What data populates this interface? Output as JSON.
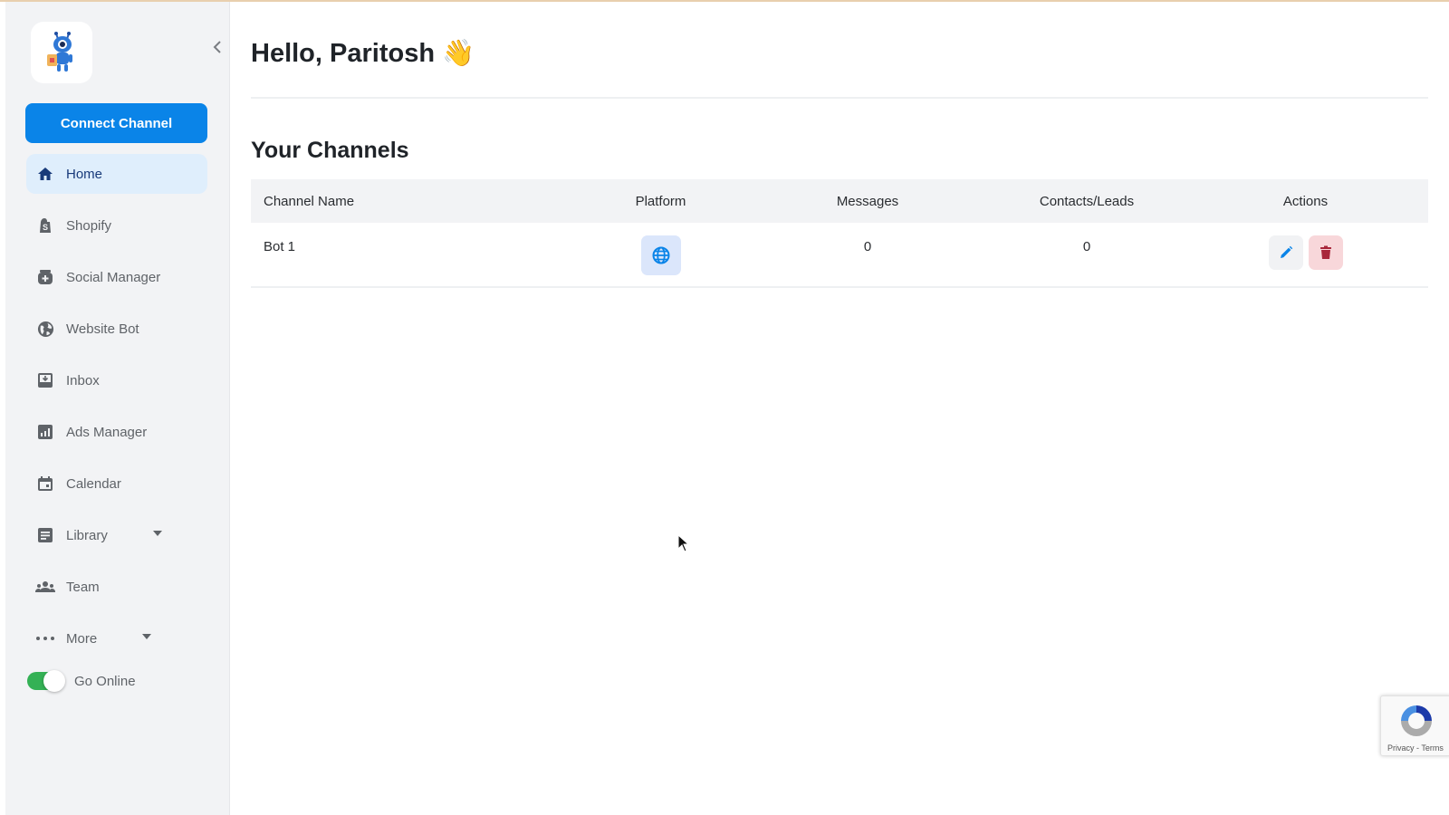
{
  "sidebar": {
    "logo_alt": "Robot mascot logo",
    "collapse_icon": "chevron-left-icon",
    "connect_button": "Connect Channel",
    "items": [
      {
        "label": "Home",
        "icon": "home-icon",
        "active": true
      },
      {
        "label": "Shopify",
        "icon": "shopify-bag-icon"
      },
      {
        "label": "Social Manager",
        "icon": "social-add-icon"
      },
      {
        "label": "Website Bot",
        "icon": "globe-icon"
      },
      {
        "label": "Inbox",
        "icon": "inbox-icon"
      },
      {
        "label": "Ads Manager",
        "icon": "bar-chart-icon"
      },
      {
        "label": "Calendar",
        "icon": "calendar-icon"
      },
      {
        "label": "Library",
        "icon": "library-icon",
        "has_dropdown": true
      },
      {
        "label": "Team",
        "icon": "team-icon"
      },
      {
        "label": "More",
        "icon": "more-dots-icon",
        "has_dropdown": true
      }
    ],
    "go_online": {
      "label": "Go Online",
      "enabled": true
    }
  },
  "main": {
    "greeting": "Hello, Paritosh 👋",
    "section_title": "Your Channels",
    "table": {
      "headers": [
        "Channel Name",
        "Platform",
        "Messages",
        "Contacts/Leads",
        "Actions"
      ],
      "rows": [
        {
          "channel_name": "Bot 1",
          "platform": "website",
          "platform_icon": "globe-icon",
          "messages": "0",
          "contacts_leads": "0",
          "actions": [
            "edit",
            "delete"
          ]
        }
      ]
    }
  },
  "recaptcha": {
    "links": "Privacy - Terms"
  },
  "colors": {
    "primary": "#0a84e8",
    "sidebar_bg": "#f2f3f5",
    "active_item_bg": "#dfeefc",
    "toggle_on": "#34b155",
    "delete_bg": "#f8d7da",
    "delete_icon": "#a8263a",
    "top_accent": "#e8cfae"
  }
}
